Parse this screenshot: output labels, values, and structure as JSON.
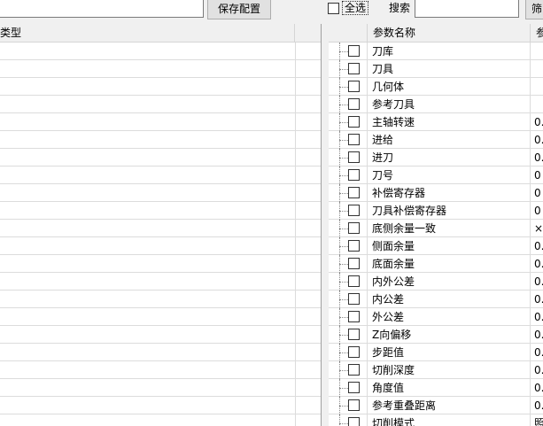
{
  "toolbar": {
    "name_value": "",
    "save_label": "保存配置",
    "select_all_label": "全选",
    "search_label": "搜索",
    "search_value": "",
    "cut_button_label": "筛"
  },
  "left_table": {
    "column_type": "类型",
    "row_count": 22
  },
  "right_table": {
    "column_name": "参数名称",
    "column_value": "参",
    "rows": [
      {
        "name": "刀库",
        "value": ""
      },
      {
        "name": "刀具",
        "value": ""
      },
      {
        "name": "几何体",
        "value": ""
      },
      {
        "name": "参考刀具",
        "value": ""
      },
      {
        "name": "主轴转速",
        "value": "0."
      },
      {
        "name": "进给",
        "value": "0."
      },
      {
        "name": "进刀",
        "value": "0."
      },
      {
        "name": "刀号",
        "value": "0"
      },
      {
        "name": "补偿寄存器",
        "value": "0"
      },
      {
        "name": "刀具补偿寄存器",
        "value": "0"
      },
      {
        "name": "底侧余量一致",
        "value": "×"
      },
      {
        "name": "侧面余量",
        "value": "0."
      },
      {
        "name": "底面余量",
        "value": "0."
      },
      {
        "name": "内外公差",
        "value": "0."
      },
      {
        "name": "内公差",
        "value": "0."
      },
      {
        "name": "外公差",
        "value": "0."
      },
      {
        "name": "Z向偏移",
        "value": "0."
      },
      {
        "name": "步距值",
        "value": "0."
      },
      {
        "name": "切削深度",
        "value": "0."
      },
      {
        "name": "角度值",
        "value": "0."
      },
      {
        "name": "参考重叠距离",
        "value": "0."
      },
      {
        "name": "切削模式",
        "value": "照"
      }
    ]
  }
}
